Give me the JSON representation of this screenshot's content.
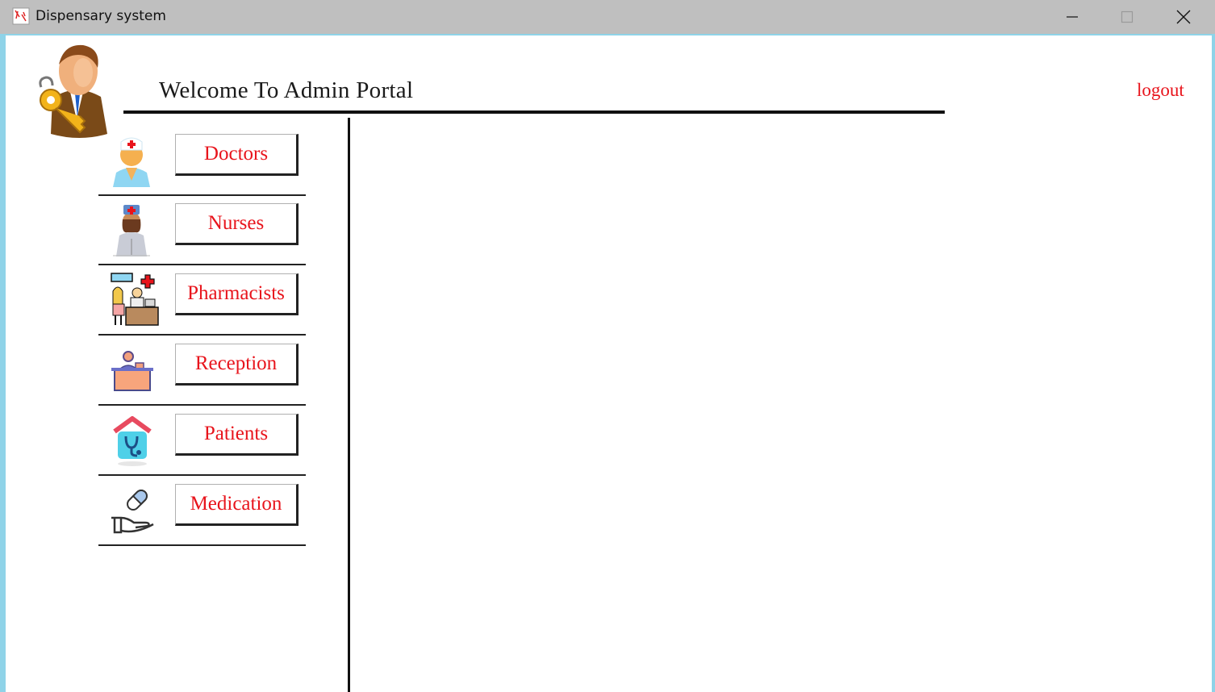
{
  "window": {
    "title": "Dispensary system",
    "buttons": [
      "minimize",
      "maximize",
      "close"
    ]
  },
  "header": {
    "title": "Welcome To Admin Portal",
    "logout_label": "logout",
    "avatar_icon": "admin-key-avatar-icon"
  },
  "sidebar": {
    "items": [
      {
        "label": "Doctors",
        "icon": "doctor-icon"
      },
      {
        "label": "Nurses",
        "icon": "nurse-icon"
      },
      {
        "label": "Pharmacists",
        "icon": "pharmacist-icon"
      },
      {
        "label": "Reception",
        "icon": "reception-icon"
      },
      {
        "label": "Patients",
        "icon": "patients-icon"
      },
      {
        "label": "Medication",
        "icon": "medication-icon"
      }
    ]
  },
  "colors": {
    "accent_text": "#e8141c",
    "titlebar": "#bfbfbf",
    "frame": "#8fd3e8"
  }
}
